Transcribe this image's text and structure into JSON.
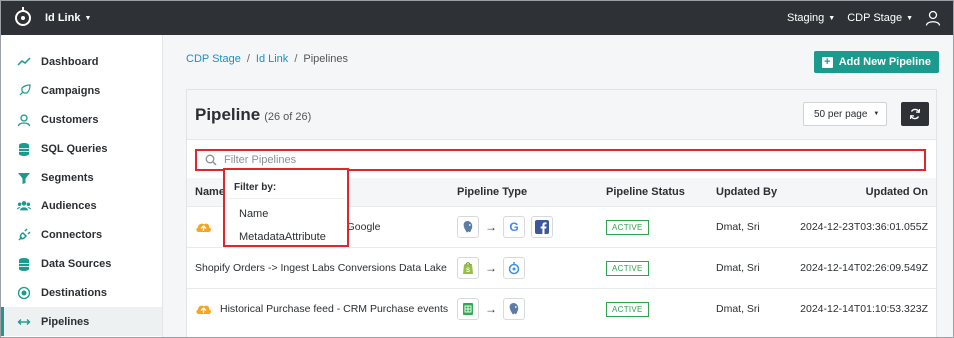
{
  "topbar": {
    "app_name": "Id Link",
    "env": "Staging",
    "workspace": "CDP Stage"
  },
  "sidebar": {
    "items": [
      {
        "label": "Dashboard",
        "icon": "chart-line-icon"
      },
      {
        "label": "Campaigns",
        "icon": "rocket-icon"
      },
      {
        "label": "Customers",
        "icon": "user-outline-icon"
      },
      {
        "label": "SQL Queries",
        "icon": "database-icon"
      },
      {
        "label": "Segments",
        "icon": "filter-icon"
      },
      {
        "label": "Audiences",
        "icon": "users-icon"
      },
      {
        "label": "Connectors",
        "icon": "plug-icon"
      },
      {
        "label": "Data Sources",
        "icon": "database-icon"
      },
      {
        "label": "Destinations",
        "icon": "target-icon"
      },
      {
        "label": "Pipelines",
        "icon": "arrows-h-icon",
        "active": true
      }
    ]
  },
  "breadcrumb": {
    "item1": "CDP Stage",
    "sep": "/",
    "item2": "Id Link",
    "item3": "Pipelines"
  },
  "add_button": {
    "label": "Add New Pipeline"
  },
  "card": {
    "title": "Pipeline",
    "count": "(26 of 26)",
    "per_page": "50 per page",
    "search_placeholder": "Filter Pipelines"
  },
  "filter_popup": {
    "label": "Filter by:",
    "options": [
      "Name",
      "MetadataAttribute"
    ]
  },
  "table": {
    "headers": {
      "name": "Name",
      "type": "Pipeline Type",
      "status": "Pipeline Status",
      "updated_by": "Updated By",
      "updated_on": "Updated On"
    },
    "rows": [
      {
        "name": "nd Google",
        "status": "ACTIVE",
        "updated_by": "Dmat, Sri",
        "updated_on": "2024-12-23T03:36:01.055Z"
      },
      {
        "name": "Shopify Orders -> Ingest Labs Conversions Data Lake",
        "status": "ACTIVE",
        "updated_by": "Dmat, Sri",
        "updated_on": "2024-12-14T02:26:09.549Z"
      },
      {
        "name": "Historical Purchase feed - CRM Purchase events",
        "status": "ACTIVE",
        "updated_by": "Dmat, Sri",
        "updated_on": "2024-12-14T01:10:53.323Z"
      }
    ]
  },
  "colors": {
    "accent": "#1b9a8e",
    "topbar": "#2e3236",
    "highlight": "#e0262c",
    "active": "#2ea44f",
    "link": "#1b8fc4"
  }
}
